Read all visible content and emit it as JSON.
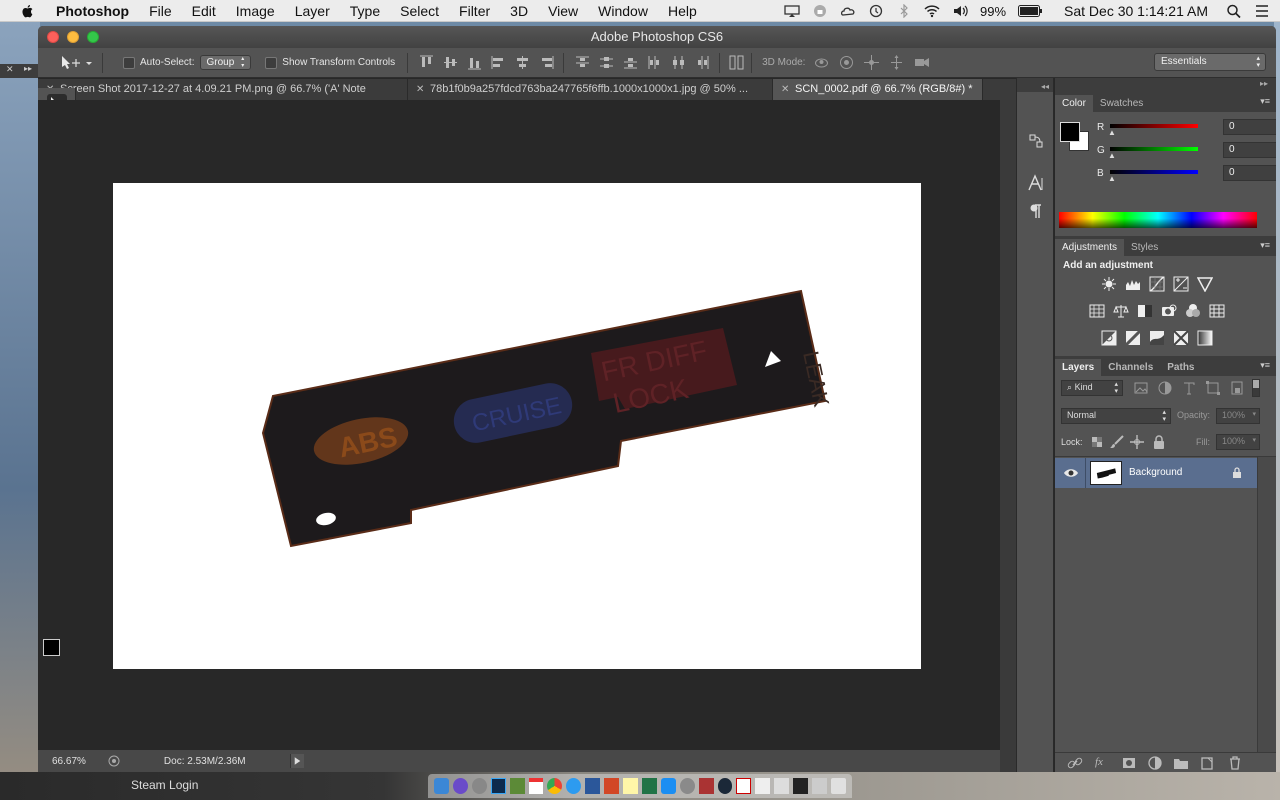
{
  "menubar": {
    "app_name": "Photoshop",
    "items": [
      "File",
      "Edit",
      "Image",
      "Layer",
      "Type",
      "Select",
      "Filter",
      "3D",
      "View",
      "Window",
      "Help"
    ],
    "battery": "99%",
    "clock": "Sat Dec 30  1:14:21 AM"
  },
  "window": {
    "title": "Adobe Photoshop CS6"
  },
  "options": {
    "auto_select_label": "Auto-Select:",
    "auto_select_value": "Group",
    "show_transform_label": "Show Transform Controls",
    "mode_3d_label": "3D Mode:",
    "workspace": "Essentials"
  },
  "tabs": [
    {
      "label": "Screen Shot 2017-12-27 at 4.09.21 PM.png @ 66.7% ('A' Note",
      "active": false
    },
    {
      "label": "78b1f0b9a257fdcd763ba247765f6ffb.1000x1000x1.jpg @ 50% ...",
      "active": false
    },
    {
      "label": "SCN_0002.pdf @ 66.7% (RGB/8#) *",
      "active": true
    }
  ],
  "status": {
    "zoom": "66.67%",
    "doc_info": "Doc: 2.53M/2.36M"
  },
  "color_panel": {
    "tabs": [
      "Color",
      "Swatches"
    ],
    "r_label": "R",
    "g_label": "G",
    "b_label": "B",
    "r": "0",
    "g": "0",
    "b": "0",
    "foreground": "#000000",
    "background": "#ffffff"
  },
  "adjustments_panel": {
    "tabs": [
      "Adjustments",
      "Styles"
    ],
    "heading": "Add an adjustment"
  },
  "layers_panel": {
    "tabs": [
      "Layers",
      "Channels",
      "Paths"
    ],
    "filter_kind": "Kind",
    "blend_mode": "Normal",
    "opacity_label": "Opacity:",
    "opacity": "100%",
    "lock_label": "Lock:",
    "fill_label": "Fill:",
    "fill": "100%",
    "layers": [
      {
        "name": "Background",
        "visible": true,
        "locked": true
      }
    ]
  },
  "taskbar": {
    "steam_label": "Steam Login"
  },
  "colors": {
    "ui_dark": "#282828",
    "ui_panel": "#535353",
    "selected_layer": "#5a6e8f"
  }
}
